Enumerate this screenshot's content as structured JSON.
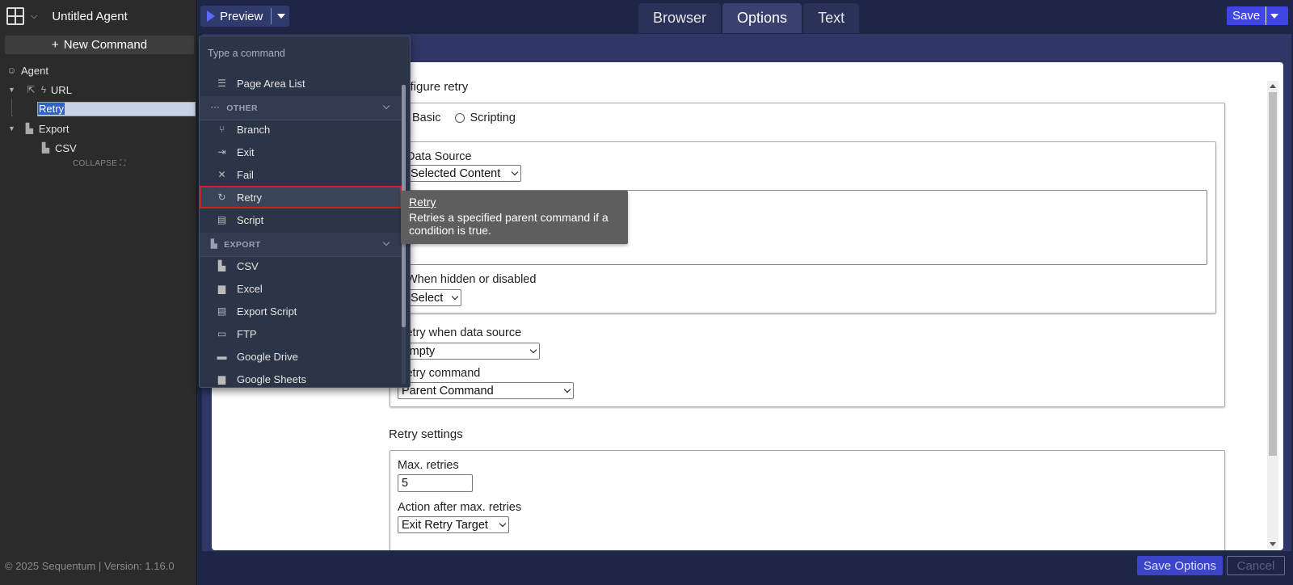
{
  "app": {
    "title": "Untitled Agent",
    "new_command": "New Command",
    "footer": "© 2025 Sequentum | Version: 1.16.0"
  },
  "tree": {
    "agent": "Agent",
    "url": "URL",
    "retry": "Retry",
    "export": "Export",
    "csv": "CSV",
    "collapse": "COLLAPSE"
  },
  "toolbar": {
    "preview": "Preview",
    "save": "Save"
  },
  "tabs": [
    {
      "label": "Browser",
      "active": false
    },
    {
      "label": "Options",
      "active": true
    },
    {
      "label": "Text",
      "active": false
    }
  ],
  "form": {
    "configure_title": "Configure retry",
    "mode_basic": "Basic",
    "mode_scripting": "Scripting",
    "mode_selected": "Basic",
    "data_source_label": "Data Source",
    "data_source_value": "Selected Content",
    "hidden_label": "When hidden or disabled",
    "hidden_value": "Select",
    "retry_when_label": "Retry when data source",
    "retry_when_value": "Empty",
    "retry_command_label": "Retry command",
    "retry_command_value": "Parent Command",
    "retry_settings_title": "Retry settings",
    "max_retries_label": "Max. retries",
    "max_retries_value": "5",
    "action_after_label": "Action after max. retries",
    "action_after_value": "Exit Retry Target"
  },
  "actions": {
    "save_options": "Save Options",
    "cancel": "Cancel"
  },
  "command_menu": {
    "search_placeholder": "Type a command",
    "items": [
      {
        "type": "item",
        "label": "Page Area List",
        "icon": "list-icon",
        "glyph": "☰"
      },
      {
        "type": "group",
        "label": "OTHER",
        "icon": "dots-icon",
        "glyph": "···"
      },
      {
        "type": "item",
        "label": "Branch",
        "icon": "branch-icon",
        "glyph": "⑂"
      },
      {
        "type": "item",
        "label": "Exit",
        "icon": "exit-icon",
        "glyph": "⇥"
      },
      {
        "type": "item",
        "label": "Fail",
        "icon": "close-icon",
        "glyph": "✕"
      },
      {
        "type": "item",
        "label": "Retry",
        "icon": "refresh-icon",
        "glyph": "↻",
        "highlighted": true
      },
      {
        "type": "item",
        "label": "Script",
        "icon": "scroll-icon",
        "glyph": "▤"
      },
      {
        "type": "group",
        "label": "EXPORT",
        "icon": "export-icon",
        "glyph": "▙"
      },
      {
        "type": "item",
        "label": "CSV",
        "icon": "csv-file-icon",
        "glyph": "▙"
      },
      {
        "type": "item",
        "label": "Excel",
        "icon": "file-icon",
        "glyph": "▆"
      },
      {
        "type": "item",
        "label": "Export Script",
        "icon": "scroll-icon",
        "glyph": "▤"
      },
      {
        "type": "item",
        "label": "FTP",
        "icon": "server-icon",
        "glyph": "▭"
      },
      {
        "type": "item",
        "label": "Google Drive",
        "icon": "folder-icon",
        "glyph": "▬"
      },
      {
        "type": "item",
        "label": "Google Sheets",
        "icon": "file-icon",
        "glyph": "▆"
      }
    ]
  },
  "tooltip": {
    "title": "Retry",
    "body": "Retries a specified parent command if a condition is true."
  }
}
